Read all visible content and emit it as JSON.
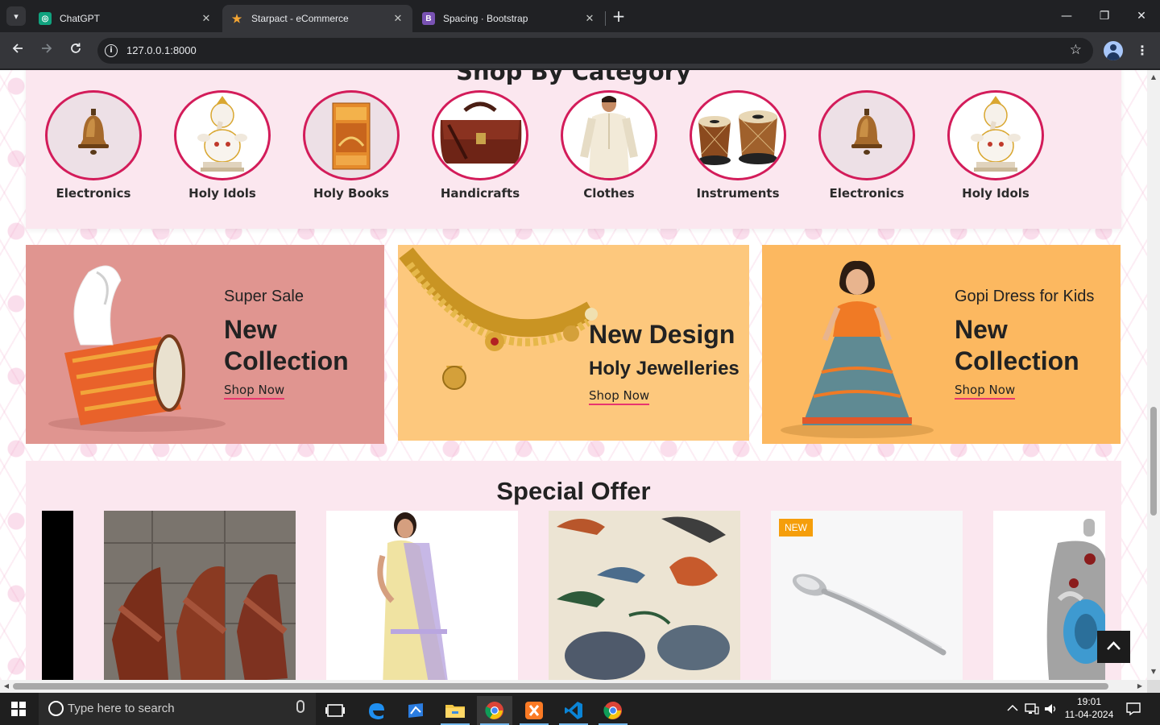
{
  "browser": {
    "tabs": [
      {
        "title": "ChatGPT",
        "close": "✕"
      },
      {
        "title": "Starpact - eCommerce",
        "close": "✕"
      },
      {
        "title": "Spacing · Bootstrap",
        "close": "✕"
      }
    ],
    "new_tab": "+",
    "url": "127.0.0.1:8000",
    "window_controls": {
      "minimize": "—",
      "maximize": "❐",
      "close": "✕"
    },
    "colors": {
      "frame": "#202124",
      "toolbar": "#35363a"
    }
  },
  "page": {
    "category_heading": "Shop By Category",
    "categories": [
      {
        "label": "Electronics",
        "icon": "bell-icon"
      },
      {
        "label": "Holy Idols",
        "icon": "ganesha-idol-icon"
      },
      {
        "label": "Holy Books",
        "icon": "book-icon"
      },
      {
        "label": "Handicrafts",
        "icon": "leather-bag-icon"
      },
      {
        "label": "Clothes",
        "icon": "kurta-man-icon"
      },
      {
        "label": "Instruments",
        "icon": "tabla-icon"
      },
      {
        "label": "Electronics",
        "icon": "bell-icon"
      },
      {
        "label": "Holy Idols",
        "icon": "ganesha-idol-icon"
      }
    ],
    "banners": [
      {
        "small": "Super Sale",
        "big": "New Collection",
        "link": "Shop Now",
        "bg": "#e09590"
      },
      {
        "big": "New Design",
        "mid": "Holy Jewelleries",
        "link": "Shop Now",
        "bg": "#fdc87d"
      },
      {
        "small": "Gopi Dress for Kids",
        "big": "New Collection",
        "link": "Shop Now",
        "bg": "#fcb860"
      }
    ],
    "special_offer": {
      "title": "Special Offer",
      "products": [
        {
          "name": "leather sandals"
        },
        {
          "name": "saree"
        },
        {
          "name": "embroidered cloth"
        },
        {
          "name": "steel spoon",
          "badge": "NEW"
        },
        {
          "name": "silver pendant"
        }
      ]
    },
    "accent": "#d31c5a"
  },
  "taskbar": {
    "search_placeholder": "Type here to search",
    "time": "19:01",
    "date": "11-04-2024"
  }
}
